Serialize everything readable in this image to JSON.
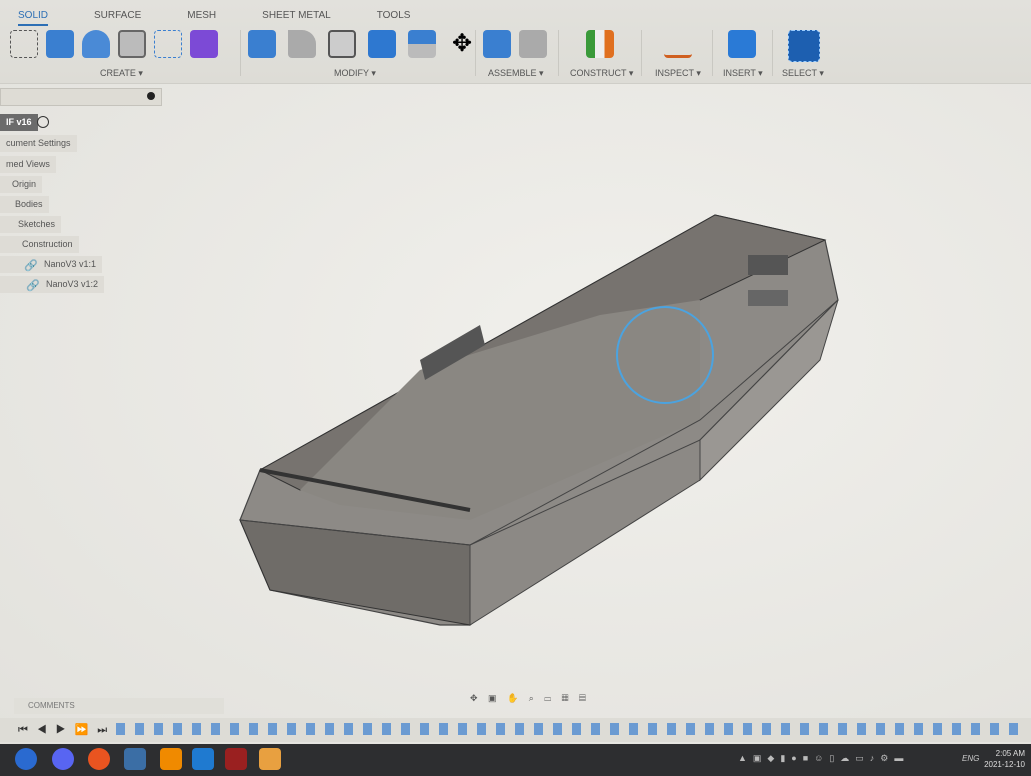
{
  "toolbar": {
    "tabs": [
      "SOLID",
      "SURFACE",
      "MESH",
      "SHEET METAL",
      "TOOLS"
    ],
    "active_tab": "SOLID",
    "groups": {
      "create": "CREATE ▾",
      "modify": "MODIFY ▾",
      "assemble": "ASSEMBLE ▾",
      "construct": "CONSTRUCT ▾",
      "inspect": "INSPECT ▾",
      "insert": "INSERT ▾",
      "select": "SELECT ▾"
    },
    "accent": "#2c6fb5"
  },
  "browser": {
    "root": "IF v16",
    "items": [
      "cument Settings",
      "med Views",
      "Origin",
      "Bodies",
      "Sketches",
      "Construction",
      "NanoV3 v1:1",
      "NanoV3 v1:2"
    ]
  },
  "comments": {
    "label": "COMMENTS"
  },
  "taskbar": {
    "lang": "ENG",
    "time": "2:05 AM",
    "date": "2021-12-10"
  }
}
